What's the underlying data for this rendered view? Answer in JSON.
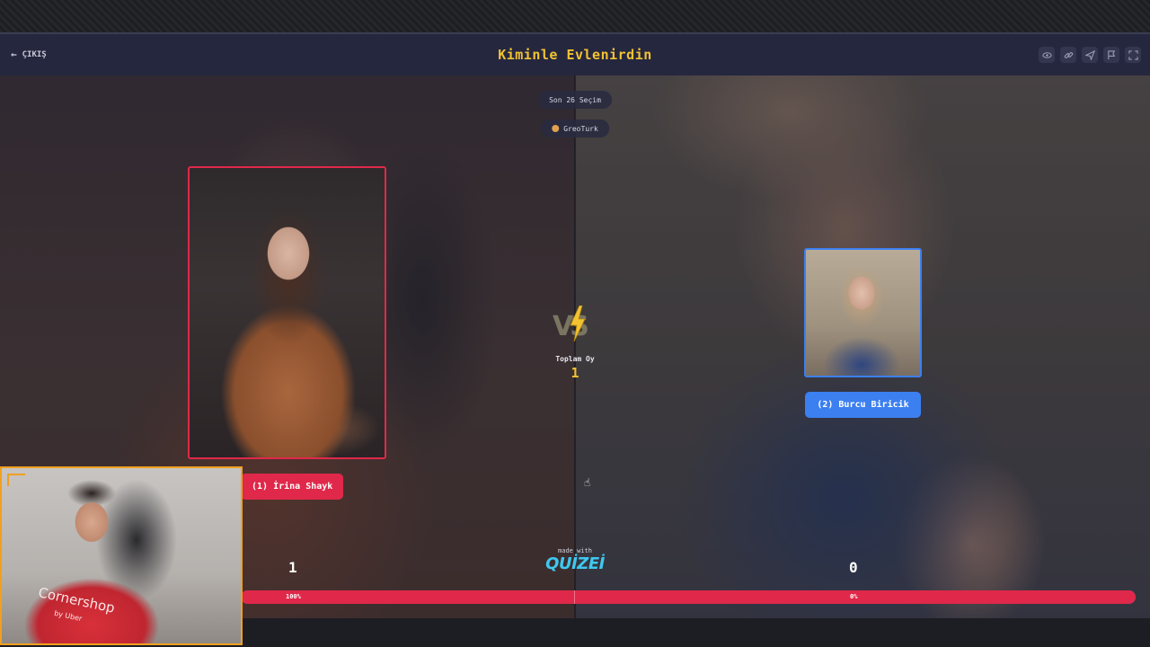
{
  "header": {
    "back_label": "ÇIKIŞ",
    "title": "Kiminle Evlenirdin",
    "icons": [
      "eye-icon",
      "link-icon",
      "send-icon",
      "flag-icon",
      "fullscreen-icon"
    ]
  },
  "stage": {
    "recent_label": "Son 26 Seçim",
    "user_label": "GreoTurk",
    "total_label": "Toplam Oy",
    "total_value": "1",
    "made_with": "made with",
    "brand": "QUİZEİ"
  },
  "left": {
    "name": "(1) İrina Shayk",
    "score": "1",
    "percent_label": "100%",
    "color": "#e0284a"
  },
  "right": {
    "name": "(2) Burcu Biricik",
    "score": "0",
    "percent_label": "0%",
    "color": "#3c7ff0"
  },
  "vote_share_left": 1.0,
  "webcam": {
    "shirt_text": "Cornershop",
    "shirt_sub": "by Uber"
  }
}
